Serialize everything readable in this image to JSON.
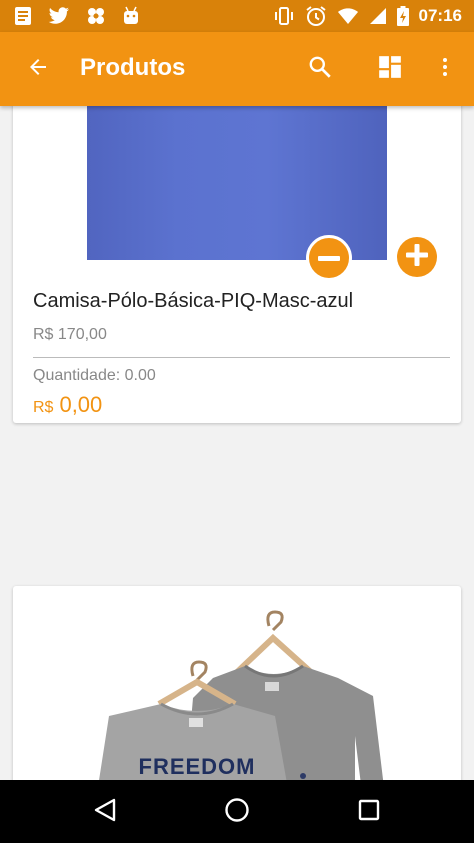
{
  "status_bar": {
    "time": "07:16",
    "left_icons": [
      "notes-icon",
      "twitter-icon",
      "pinwheel-icon",
      "android-icon"
    ],
    "right_icons": [
      "vibrate-icon",
      "alarm-icon",
      "wifi-icon",
      "signal-icon",
      "battery-charging-icon"
    ]
  },
  "app_bar": {
    "title": "Produtos",
    "actions": [
      "search-icon",
      "dashboard-icon",
      "more-vert-icon"
    ]
  },
  "products": [
    {
      "name": "Camisa-Pólo-Básica-PIQ-Masc-azul",
      "price": "R$ 170,00",
      "quantity": "Quantidade: 0.00",
      "total_currency": "R$",
      "total_value": "0,00"
    },
    {
      "image_text": "FREEDOM"
    }
  ],
  "colors": {
    "status_bar": "#d9820a",
    "app_bar": "#f29312",
    "accent": "#f29312",
    "background": "#f2f2f2"
  }
}
